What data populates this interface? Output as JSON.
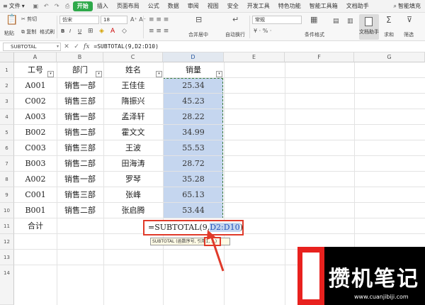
{
  "menubar": {
    "file_label": "文件",
    "tabs": [
      "开始",
      "插入",
      "页面布局",
      "公式",
      "数据",
      "审阅",
      "视图",
      "安全",
      "开发工具",
      "特色功能",
      "智能工具箱",
      "文档助手"
    ],
    "active_tab": "开始",
    "search_label": "智能填充"
  },
  "ribbon": {
    "paste": "粘贴",
    "cut": "剪切",
    "copy": "复制",
    "format_painter": "格式刷",
    "font_name": "仿宋",
    "font_size": "18",
    "bold": "B",
    "italic": "I",
    "underline": "U",
    "merge_center": "合并居中",
    "wrap_text": "自动换行",
    "number_format": "常规",
    "conditional_format": "条件格式",
    "doc_helper": "文档助手",
    "sum": "求和",
    "filter": "筛选"
  },
  "formula_bar": {
    "name_box": "SUBTOTAL",
    "formula": "=SUBTOTAL(9,D2:D10)",
    "fx": "fx"
  },
  "columns": [
    "A",
    "B",
    "C",
    "D",
    "E",
    "F",
    "G"
  ],
  "rows": [
    "1",
    "2",
    "3",
    "4",
    "5",
    "6",
    "7",
    "8",
    "9",
    "10",
    "11",
    "12",
    "13",
    "14"
  ],
  "table": {
    "headers": [
      "工号",
      "部门",
      "姓名",
      "销量"
    ],
    "data": [
      [
        "A001",
        "销售一部",
        "王佳佳",
        "25.34"
      ],
      [
        "C002",
        "销售三部",
        "隋振兴",
        "45.23"
      ],
      [
        "A003",
        "销售一部",
        "孟泽轩",
        "28.22"
      ],
      [
        "B002",
        "销售二部",
        "霍文文",
        "34.99"
      ],
      [
        "C003",
        "销售三部",
        "王波",
        "55.53"
      ],
      [
        "B003",
        "销售二部",
        "田海涛",
        "28.72"
      ],
      [
        "A002",
        "销售一部",
        "罗琴",
        "35.28"
      ],
      [
        "C001",
        "销售三部",
        "张峰",
        "65.13"
      ],
      [
        "B001",
        "销售二部",
        "张启腾",
        "53.44"
      ]
    ],
    "total_label": "合计"
  },
  "edit_cell": {
    "prefix": "=SUBTOTAL(9,",
    "ref": "D2:D10",
    "suffix": ")"
  },
  "tooltip": "SUBTOTAL (函数序号, 引用1, ...)",
  "watermark": {
    "brand": "攒机笔记",
    "url": "www.cuanjibiji.com"
  },
  "colors": {
    "accent_green": "#2ea94a",
    "selection": "#c5d6ef",
    "highlight_red": "#e03a2a"
  }
}
